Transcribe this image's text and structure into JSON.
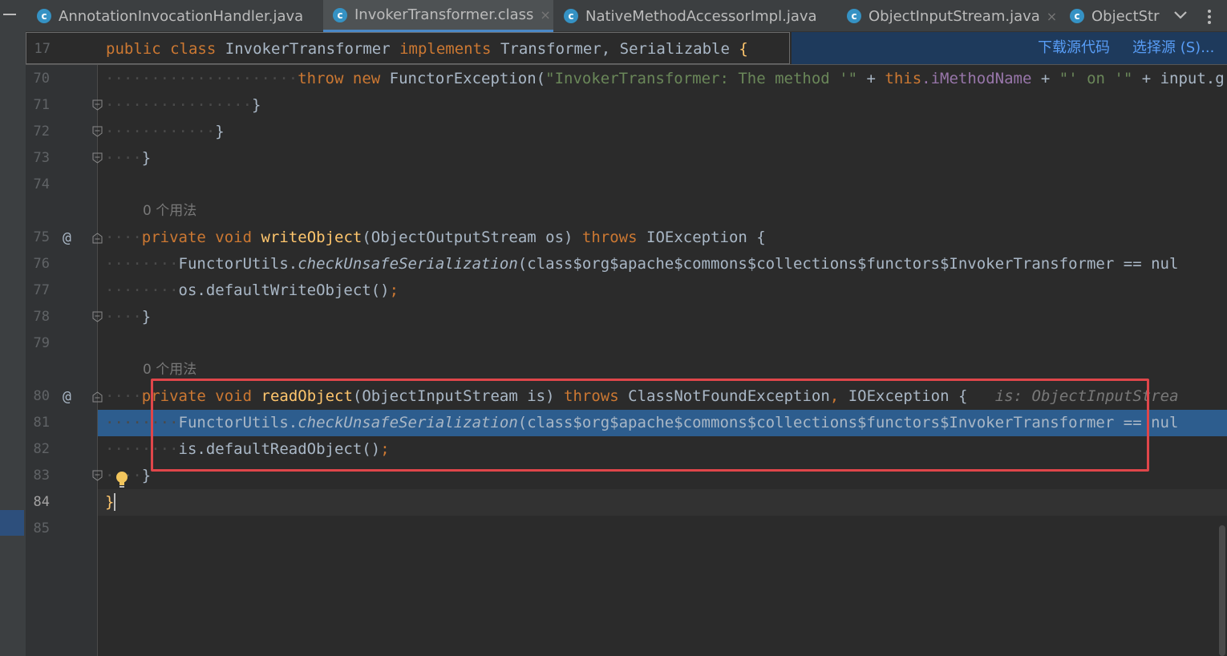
{
  "tabs": [
    {
      "label": "AnnotationInvocationHandler.java",
      "icon": "c",
      "active": false,
      "closable": false
    },
    {
      "label": "InvokerTransformer.class",
      "icon": "c",
      "active": true,
      "closable": true
    },
    {
      "label": "NativeMethodAccessorImpl.java",
      "icon": "c",
      "active": false,
      "closable": true
    },
    {
      "label": "ObjectInputStream.java",
      "icon": "c",
      "active": false,
      "closable": true
    },
    {
      "label": "ObjectStr",
      "icon": "c",
      "active": false,
      "closable": false
    }
  ],
  "tab_close_glyph": "×",
  "sticky": {
    "line_number": "17",
    "code_public": "public",
    "code_class": "class",
    "code_name": "InvokerTransformer",
    "code_implements": "implements",
    "code_rest": "Transformer, Serializable",
    "code_brace": "{"
  },
  "banner": {
    "download_source": "下载源代码",
    "choose_source": "选择源 (S)..."
  },
  "usage_hint": "0 个用法",
  "lines": {
    "l70": {
      "num": "70",
      "throw": "throw",
      "new": "new",
      "call": "FunctorException(",
      "str1": "\"InvokerTransformer: The method '\"",
      "plus1": " + ",
      "this": "this",
      "field": ".iMethodName",
      "plus2": " + ",
      "str2": "\"' on '\"",
      "plus3": " + ",
      "tail": "input.g"
    },
    "l71": {
      "num": "71",
      "brace": "}"
    },
    "l72": {
      "num": "72",
      "brace": "}"
    },
    "l73": {
      "num": "73",
      "brace": "}"
    },
    "l74": {
      "num": "74"
    },
    "l75": {
      "num": "75",
      "at": "@",
      "private": "private",
      "void": "void",
      "method": "writeObject",
      "params": "(ObjectOutputStream os)",
      "throws": "throws",
      "exc": "IOException {"
    },
    "l76": {
      "num": "76",
      "cls": "FunctorUtils.",
      "method": "checkUnsafeSerialization",
      "args": "(class$org$apache$commons$collections$functors$InvokerTransformer == nul"
    },
    "l77": {
      "num": "77",
      "call": "os.defaultWriteObject()",
      "semi": ";"
    },
    "l78": {
      "num": "78",
      "brace": "}"
    },
    "l79": {
      "num": "79"
    },
    "l80": {
      "num": "80",
      "at": "@",
      "private": "private",
      "void": "void",
      "method": "readObject",
      "params": "(ObjectInputStream is)",
      "throws": "throws",
      "exc1": "ClassNotFoundException",
      "comma": ",",
      "exc2": "IOException {",
      "inlay": "is: ObjectInputStrea"
    },
    "l81": {
      "num": "81",
      "cls": "FunctorUtils.",
      "method": "checkUnsafeSerialization",
      "args": "(class$org$apache$commons$collections$functors$InvokerTransformer == nul"
    },
    "l82": {
      "num": "82",
      "call": "is.defaultReadObject()",
      "semi": ";"
    },
    "l83": {
      "num": "83",
      "brace": "}"
    },
    "l84": {
      "num": "84",
      "brace": "}"
    },
    "l85": {
      "num": "85"
    }
  },
  "colors": {
    "keyword": "#cc7832",
    "method": "#ffc66d",
    "string": "#6a8759",
    "field": "#9876aa",
    "highlight": "#2d5d8e",
    "annotation_box": "#e0464a"
  }
}
